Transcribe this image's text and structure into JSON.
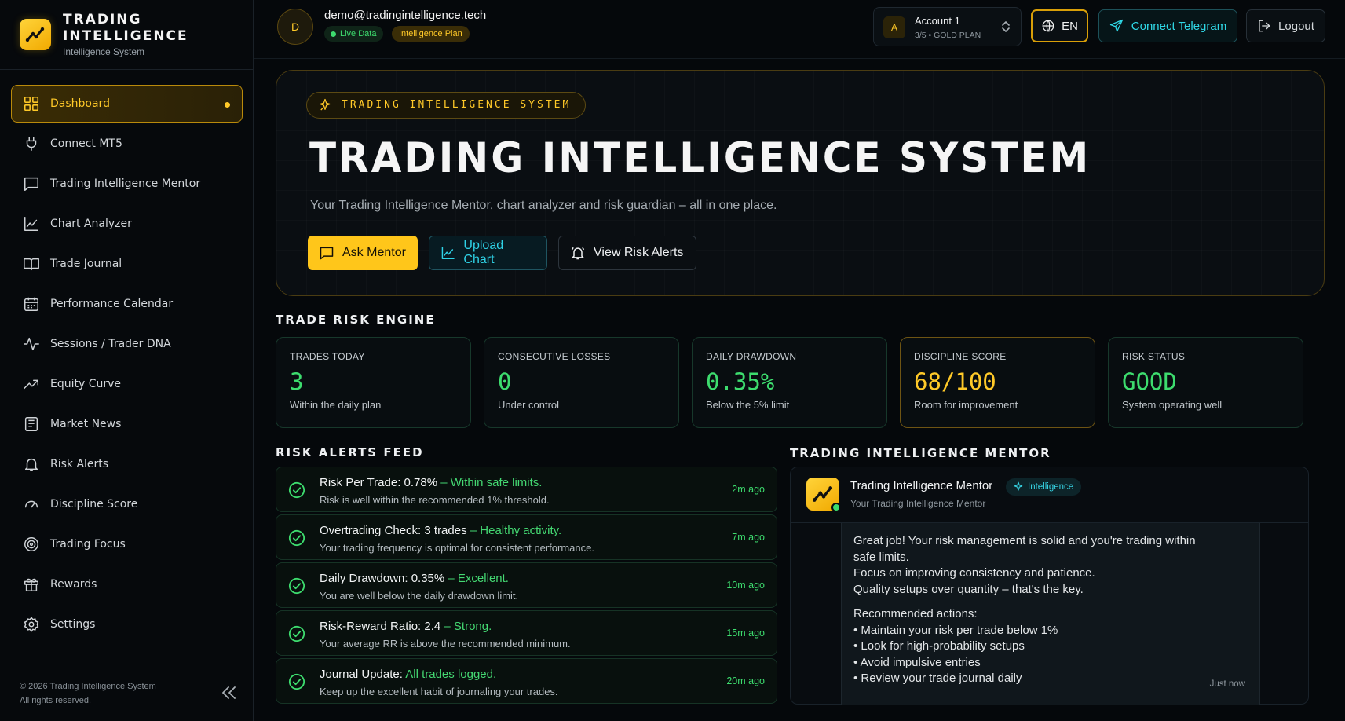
{
  "brand": {
    "title": "TRADING INTELLIGENCE",
    "subtitle": "Intelligence System",
    "logo_icon": "trend-chart-icon"
  },
  "sidebar": {
    "items": [
      {
        "label": "Dashboard",
        "icon": "grid-icon",
        "active": true
      },
      {
        "label": "Connect MT5",
        "icon": "plug-icon"
      },
      {
        "label": "Trading Intelligence Mentor",
        "icon": "chat-icon"
      },
      {
        "label": "Chart Analyzer",
        "icon": "line-chart-icon"
      },
      {
        "label": "Trade Journal",
        "icon": "book-icon"
      },
      {
        "label": "Performance Calendar",
        "icon": "calendar-icon"
      },
      {
        "label": "Sessions / Trader DNA",
        "icon": "pulse-icon"
      },
      {
        "label": "Equity Curve",
        "icon": "trend-up-icon"
      },
      {
        "label": "Market News",
        "icon": "newspaper-icon"
      },
      {
        "label": "Risk Alerts",
        "icon": "bell-icon"
      },
      {
        "label": "Discipline Score",
        "icon": "gauge-icon"
      },
      {
        "label": "Trading Focus",
        "icon": "target-icon"
      },
      {
        "label": "Rewards",
        "icon": "gift-icon"
      },
      {
        "label": "Settings",
        "icon": "gear-icon"
      }
    ],
    "footer_line1": "© 2026 Trading Intelligence System",
    "footer_line2": "All rights reserved."
  },
  "topbar": {
    "avatar_letter": "D",
    "email": "demo@tradingintelligence.tech",
    "live_badge": "Live Data",
    "plan_badge": "Intelligence Plan",
    "account": {
      "letter": "A",
      "name": "Account 1",
      "sub": "3/5 • GOLD PLAN"
    },
    "language": "EN",
    "telegram_label": "Connect Telegram",
    "logout_label": "Logout"
  },
  "hero": {
    "tag": "TRADING INTELLIGENCE SYSTEM",
    "title": "TRADING INTELLIGENCE SYSTEM",
    "subtitle": "Your Trading Intelligence Mentor, chart analyzer and risk guardian – all in one place.",
    "buttons": {
      "ask": "Ask Mentor",
      "upload": "Upload Chart",
      "risk": "View Risk Alerts"
    }
  },
  "risk_engine": {
    "title": "TRADE RISK ENGINE",
    "cards": [
      {
        "label": "TRADES TODAY",
        "value": "3",
        "sub": "Within the daily plan"
      },
      {
        "label": "CONSECUTIVE LOSSES",
        "value": "0",
        "sub": "Under control"
      },
      {
        "label": "DAILY DRAWDOWN",
        "value": "0.35%",
        "sub": "Below the 5% limit"
      },
      {
        "label": "DISCIPLINE SCORE",
        "value": "68/100",
        "sub": "Room for improvement"
      },
      {
        "label": "RISK STATUS",
        "value": "GOOD",
        "sub": "System operating well"
      }
    ]
  },
  "colors": {
    "accent_gold": "#ffc928",
    "success_green": "#3ddc6e",
    "cyan": "#2fd8e6",
    "background": "#05080b"
  },
  "alerts_feed": {
    "title": "RISK ALERTS FEED",
    "items": [
      {
        "title": "Risk Per Trade: 0.78%",
        "status": " – Within safe limits.",
        "desc": "Risk is well within the recommended 1% threshold.",
        "time": "2m ago"
      },
      {
        "title": "Overtrading Check: 3 trades",
        "status": " – Healthy activity.",
        "desc": "Your trading frequency is optimal for consistent performance.",
        "time": "7m ago"
      },
      {
        "title": "Daily Drawdown: 0.35%",
        "status": " – Excellent.",
        "desc": "You are well below the daily drawdown limit.",
        "time": "10m ago"
      },
      {
        "title": "Risk-Reward Ratio: 2.4",
        "status": " – Strong.",
        "desc": "Your average RR is above the recommended minimum.",
        "time": "15m ago"
      },
      {
        "title": "Journal Update:",
        "status": " All trades logged.",
        "desc": "Keep up the excellent habit of journaling your trades.",
        "time": "20m ago"
      }
    ]
  },
  "mentor": {
    "section_title": "TRADING INTELLIGENCE MENTOR",
    "name": "Trading Intelligence Mentor",
    "badge": "Intelligence",
    "role": "Your Trading Intelligence Mentor",
    "message": {
      "line1": "Great job! Your risk management is solid and you're trading within",
      "line2": "safe limits.",
      "line3": "Focus on improving consistency and patience.",
      "line4": "Quality setups over quantity – that's the key.",
      "actions_title": "Recommended actions:",
      "actions": [
        "• Maintain your risk per trade below 1%",
        "• Look for high-probability setups",
        "• Avoid impulsive entries",
        "• Review your trade journal daily"
      ]
    },
    "time": "Just now"
  }
}
